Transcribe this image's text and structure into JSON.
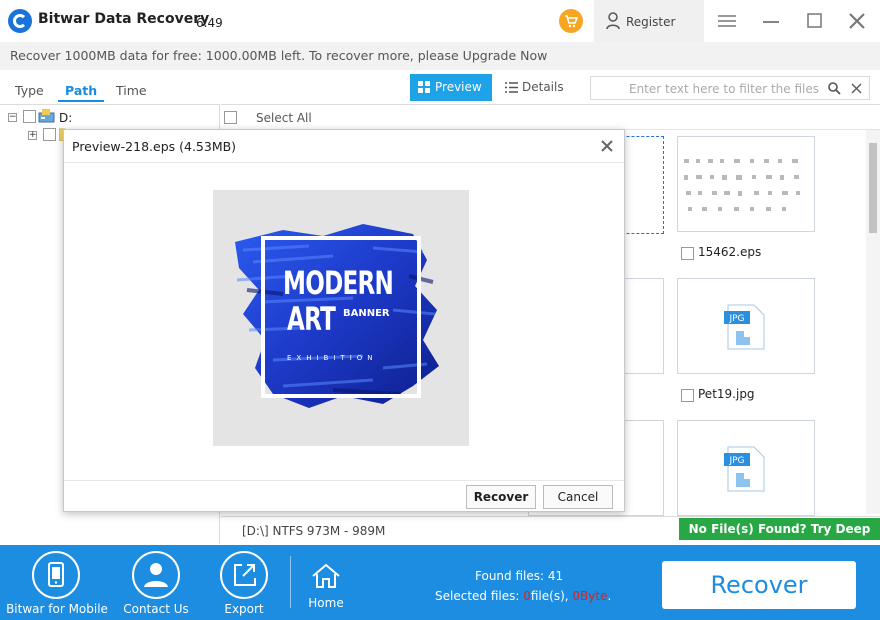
{
  "app": {
    "title": "Bitwar Data Recovery",
    "version": "6.49",
    "register_label": "Register"
  },
  "banner": {
    "text": "Recover 1000MB data for free: 1000.00MB left. To recover more, please Upgrade Now"
  },
  "tabs": [
    {
      "label": "Type"
    },
    {
      "label": "Path",
      "active": true
    },
    {
      "label": "Time"
    }
  ],
  "view": {
    "preview_label": "Preview",
    "details_label": "Details"
  },
  "filter": {
    "placeholder": "Enter text here to filter the files",
    "value": ""
  },
  "tree": {
    "root_label": "D:"
  },
  "list_header": {
    "select_all_label": "Select All"
  },
  "files": [
    {
      "name": "15462.eps",
      "icon": "eps-thumbnail"
    },
    {
      "name": "Pet19.jpg",
      "icon": "jpg-file-icon"
    },
    {
      "name": "",
      "icon": "jpg-file-icon"
    }
  ],
  "status": {
    "path_info": "[D:\\] NTFS 973M - 989M",
    "deep_scan": "No File(s) Found? Try Deep Scan"
  },
  "bottom": {
    "mobile_label": "Bitwar for Mobile",
    "contact_label": "Contact Us",
    "export_label": "Export",
    "home_label": "Home",
    "found_prefix": "Found files: ",
    "found_count": "41",
    "selected_prefix": "Selected files: ",
    "selected_count": "0",
    "selected_files_word": "file(s), ",
    "selected_size": "0Byte",
    "selected_end": ".",
    "recover_label": "Recover"
  },
  "dialog": {
    "title": "Preview-218.eps (4.53MB)",
    "image_text_line1": "MODERN",
    "image_text_line2": "ART",
    "image_text_banner": "BANNER",
    "image_text_exhibition": "EXHIBITION",
    "recover_label": "Recover",
    "cancel_label": "Cancel"
  },
  "colors": {
    "accent": "#1c8de0",
    "preview_button": "#1ea2e8",
    "deep_scan": "#28a745",
    "cart": "#f5a623",
    "highlight_red": "#e02020"
  }
}
